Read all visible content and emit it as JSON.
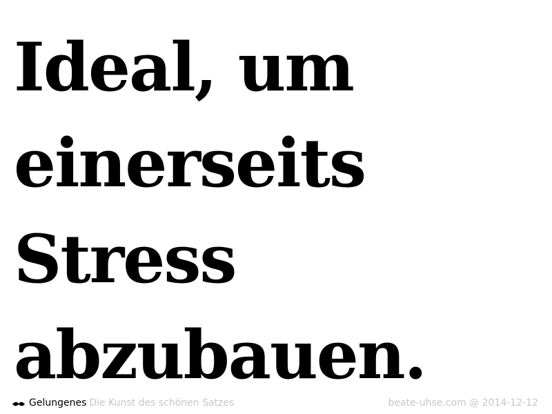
{
  "quote": {
    "lines": [
      "Ideal, um",
      "einerseits",
      "Stress",
      "abzubauen."
    ]
  },
  "footer": {
    "brand_icon": "mustache-icon",
    "brand_name": "Gelungenes",
    "tagline": "Die Kunst des schönen Satzes",
    "source": "beate-uhse.com",
    "separator": "@",
    "date": "2014-12-12"
  },
  "colors": {
    "text": "#000000",
    "muted": "#c6c6c6",
    "background": "#ffffff"
  }
}
